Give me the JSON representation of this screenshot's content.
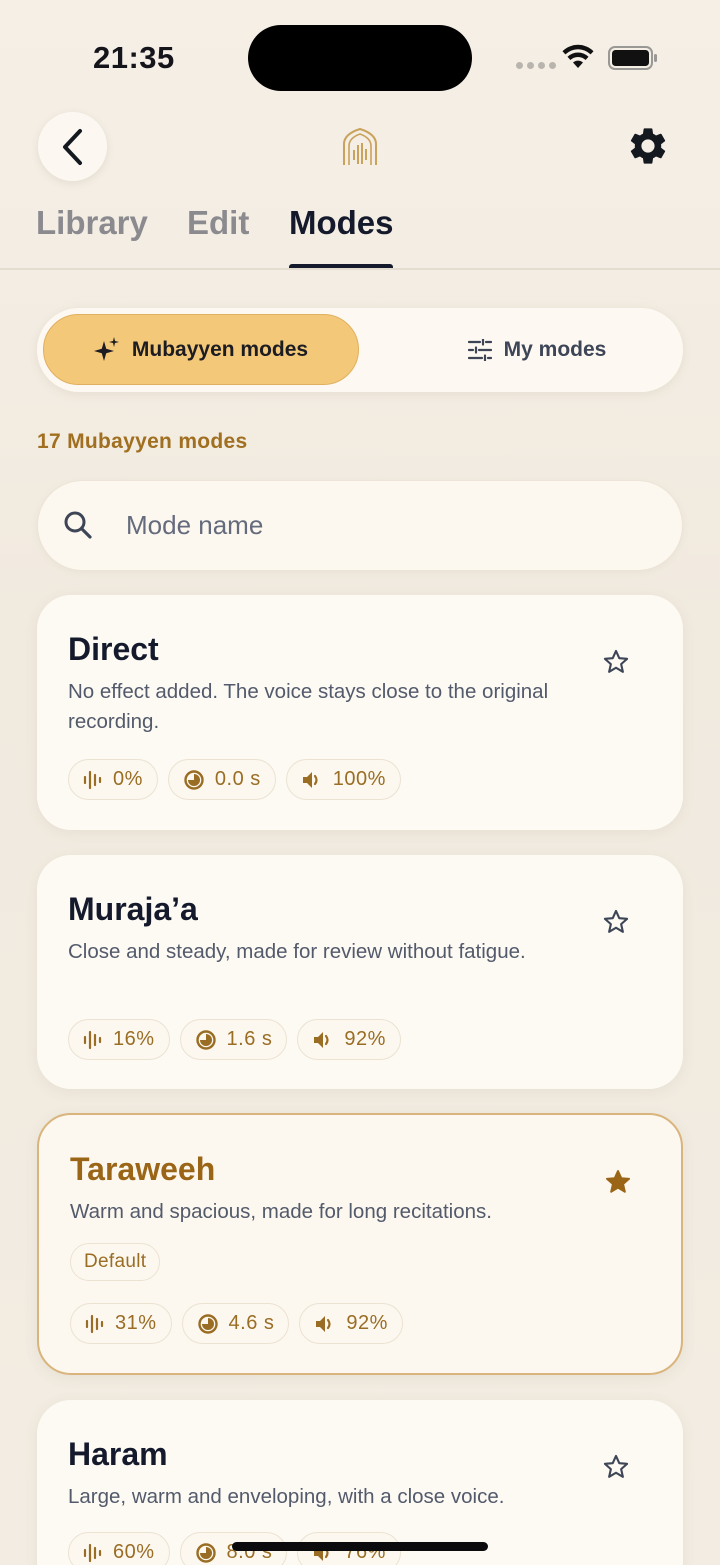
{
  "status_bar": {
    "time": "21:35"
  },
  "tabs": [
    {
      "label": "Library",
      "active": false
    },
    {
      "label": "Edit",
      "active": false
    },
    {
      "label": "Modes",
      "active": true
    }
  ],
  "segment": {
    "primary_label": "Mubayyen modes",
    "secondary_label": "My modes",
    "selected": "Mubayyen modes"
  },
  "count_text": "17 Mubayyen modes",
  "search": {
    "placeholder": "Mode name",
    "value": ""
  },
  "cards": [
    {
      "title": "Direct",
      "description": "No effect added. The voice stays close to the original recording.",
      "favorite": false,
      "default_label": "",
      "reverb": "0%",
      "decay": "0.0 s",
      "volume": "100%"
    },
    {
      "title": "Muraja’a",
      "description": "Close and steady, made for review without fatigue.",
      "favorite": false,
      "default_label": "",
      "reverb": "16%",
      "decay": "1.6 s",
      "volume": "92%"
    },
    {
      "title": "Taraweeh",
      "description": "Warm and spacious, made for long recitations.",
      "favorite": true,
      "default_label": "Default",
      "reverb": "31%",
      "decay": "4.6 s",
      "volume": "92%"
    },
    {
      "title": "Haram",
      "description": "Large, warm and enveloping, with a close voice.",
      "favorite": false,
      "default_label": "",
      "reverb": "60%",
      "decay": "8.0 s",
      "volume": "76%"
    }
  ],
  "colors": {
    "accent": "#f3c878",
    "accent_text": "#9a6517",
    "chip_text": "#9a6d24",
    "text_dark": "#141a2b"
  },
  "icons": [
    "back-arrow-icon",
    "mihrab-logo-icon",
    "gear-icon",
    "sparkles-icon",
    "sliders-icon",
    "search-icon",
    "star-icon",
    "waveform-icon",
    "decay-timer-icon",
    "speaker-icon"
  ]
}
